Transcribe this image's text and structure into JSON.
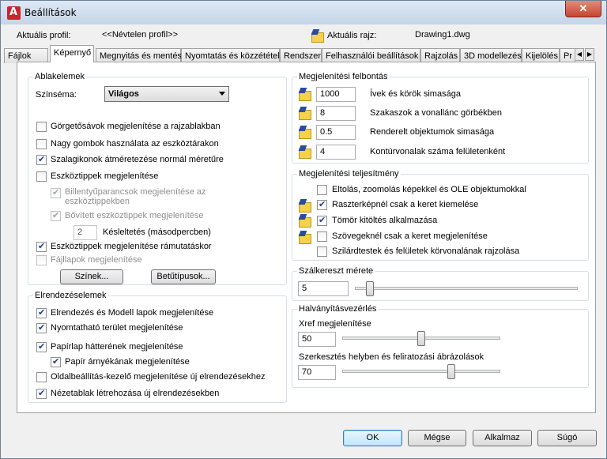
{
  "window": {
    "title": "Beállítások",
    "close": "✕"
  },
  "header": {
    "profile_label": "Aktuális profil:",
    "profile_value": "<<Névtelen profil>>",
    "drawing_label": "Aktuális rajz:",
    "drawing_value": "Drawing1.dwg"
  },
  "tabs": [
    "Fájlok",
    "Képernyő",
    "Megnyitás és mentés",
    "Nyomtatás és közzététel",
    "Rendszer",
    "Felhasználói beállítások",
    "Rajzolás",
    "3D modellezés",
    "Kijelölés",
    "Pr"
  ],
  "active_tab": "Képernyő",
  "window_elements": {
    "title": "Ablakelemek",
    "color_scheme_label": "Színséma:",
    "color_scheme_value": "Világos",
    "options": [
      {
        "label": "Görgetősávok megjelenítése a rajzablakban",
        "checked": false
      },
      {
        "label": "Nagy gombok használata az eszköztárakon",
        "checked": false
      },
      {
        "label": "Szalagikonok átméretezése normál méretűre",
        "checked": true
      },
      {
        "label": "Eszköztippek megjelenítése",
        "checked": false
      },
      {
        "label": "Billentyűparancsok megjelenítése az eszköztippekben",
        "checked": true,
        "disabled": true
      },
      {
        "label": "Bővített eszköztippek megjelenítése",
        "checked": true,
        "disabled": true
      },
      {
        "label": "Eszköztippek megjelenítése rámutatáskor",
        "checked": true
      },
      {
        "label": "Fájllapok megjelenítése",
        "checked": false,
        "disabled": true
      }
    ],
    "delay_value": "2",
    "delay_label": "Késleltetés (másodpercben)",
    "colors_button": "Színek...",
    "fonts_button": "Betűtípusok..."
  },
  "layout_elements": {
    "title": "Elrendezéselemek",
    "options": [
      {
        "label": "Elrendezés és Modell lapok megjelenítése",
        "checked": true
      },
      {
        "label": "Nyomtatható terület megjelenítése",
        "checked": true
      },
      {
        "label": "Papírlap hátterének megjelenítése",
        "checked": true
      },
      {
        "label": "Papír árnyékának megjelenítése",
        "checked": true
      },
      {
        "label": "Oldalbeállítás-kezelő megjelenítése új elrendezésekhez",
        "checked": false
      },
      {
        "label": "Nézetablak létrehozása új elrendezésekben",
        "checked": true
      }
    ]
  },
  "resolution": {
    "title": "Megjelenítési felbontás",
    "rows": [
      {
        "value": "1000",
        "label": "Ívek és körök simasága"
      },
      {
        "value": "8",
        "label": "Szakaszok a vonallánc görbékben"
      },
      {
        "value": "0.5",
        "label": "Renderelt objektumok simasága"
      },
      {
        "value": "4",
        "label": "Kontúrvonalak száma felületenként"
      }
    ]
  },
  "performance": {
    "title": "Megjelenítési teljesítmény",
    "options": [
      {
        "label": "Eltolás, zoomolás képekkel és OLE objektumokkal",
        "checked": false,
        "icon": false
      },
      {
        "label": "Raszterképnél csak a keret kiemelése",
        "checked": true,
        "icon": true
      },
      {
        "label": "Tömör kitöltés alkalmazása",
        "checked": true,
        "icon": true
      },
      {
        "label": "Szövegeknél csak a keret megjelenítése",
        "checked": false,
        "icon": true
      },
      {
        "label": "Szilárdtestek és felületek körvonalának rajzolása",
        "checked": false,
        "icon": false
      }
    ]
  },
  "crosshair": {
    "title": "Szálkereszt mérete",
    "value": "5",
    "level": 5
  },
  "fade": {
    "title": "Halványításvezérlés",
    "xref_label": "Xref megjelenítése",
    "xref_value": "50",
    "xref_level": 50,
    "inplace_label": "Szerkesztés helyben és feliratozási ábrázolások",
    "inplace_value": "70",
    "inplace_level": 70
  },
  "buttons": {
    "ok": "OK",
    "cancel": "Mégse",
    "apply": "Alkalmaz",
    "help": "Súgó"
  }
}
